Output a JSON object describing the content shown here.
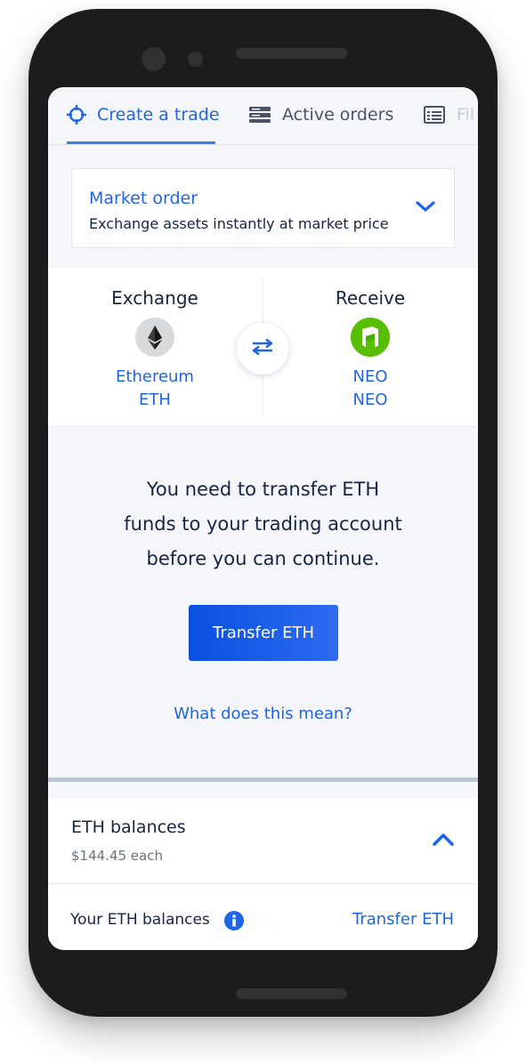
{
  "tabs": [
    {
      "label": "Create a trade",
      "icon": "crosshair-icon",
      "active": true
    },
    {
      "label": "Active orders",
      "icon": "orders-list-icon",
      "active": false
    },
    {
      "label": "Fil",
      "icon": "history-list-icon",
      "active": false
    }
  ],
  "order_type": {
    "title": "Market order",
    "subtitle": "Exchange assets instantly at market price"
  },
  "exchange": {
    "from_title": "Exchange",
    "from_name": "Ethereum",
    "from_code": "ETH",
    "to_title": "Receive",
    "to_name": "NEO",
    "to_code": "NEO"
  },
  "message": {
    "line1": "You need to transfer ETH",
    "line2": "funds to your trading account",
    "line3": "before you can continue.",
    "button": "Transfer ETH",
    "link": "What does this mean?"
  },
  "balances": {
    "title": "ETH balances",
    "price": "$144.45 each",
    "your_label": "Your ETH balances",
    "transfer_link": "Transfer ETH"
  },
  "colors": {
    "accent": "#1f66e6",
    "text": "#172542",
    "button": "#0a50e0",
    "neo": "#58bf00"
  }
}
